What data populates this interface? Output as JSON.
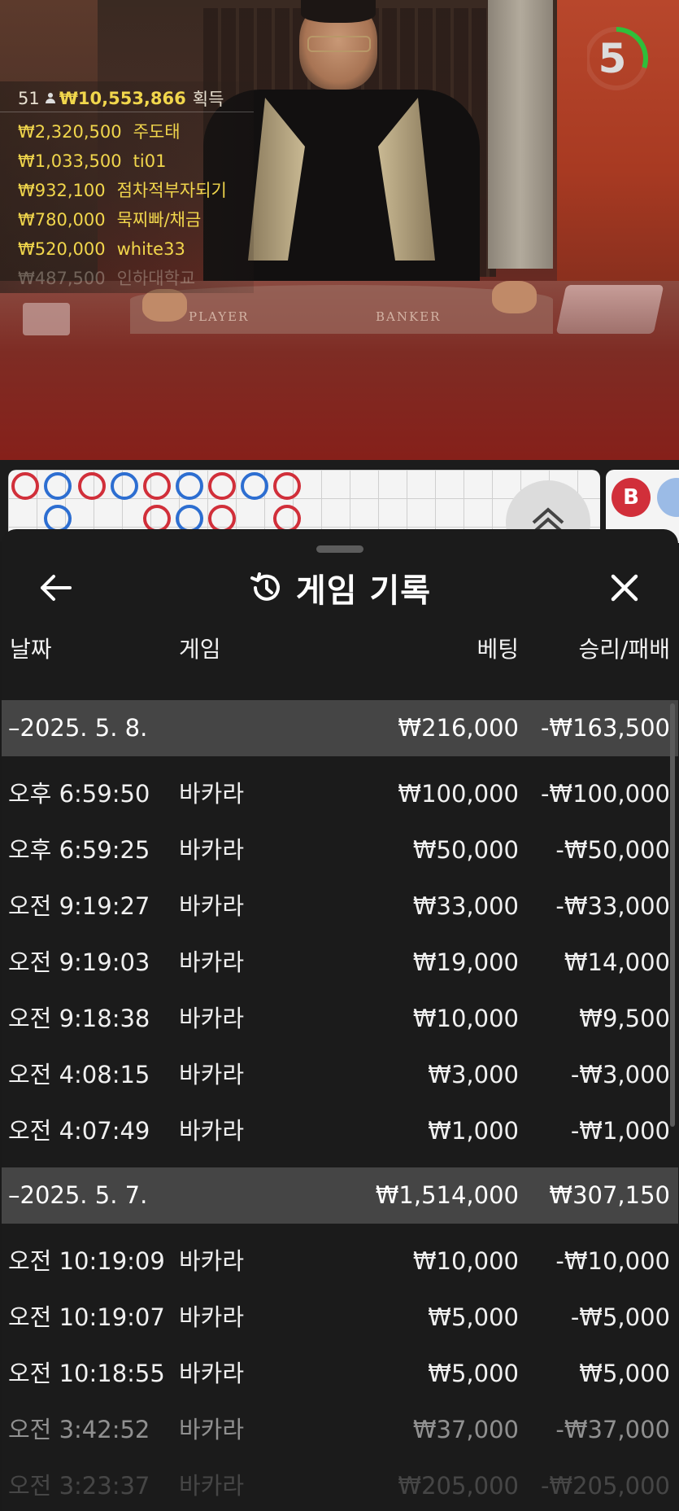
{
  "video": {
    "felt_player": "PLAYER",
    "felt_banker": "BANKER",
    "timer": {
      "value": "5",
      "progress": 0.3,
      "color": "#2fbf3a"
    }
  },
  "leaderboard": {
    "count": "51",
    "total": "₩10,553,866",
    "suffix": "획득",
    "entries": [
      {
        "amount": "₩2,320,500",
        "name": "주도태"
      },
      {
        "amount": "₩1,033,500",
        "name": "ti01"
      },
      {
        "amount": "₩932,100",
        "name": "점차적부자되기"
      },
      {
        "amount": "₩780,000",
        "name": "묵찌빠/채금"
      },
      {
        "amount": "₩520,000",
        "name": "white33"
      },
      {
        "amount": "₩487,500",
        "name": "인하대학교"
      }
    ]
  },
  "roadmap": {
    "badge": "B",
    "player_color": "#2d6ed1",
    "banker_color": "#d12f3a"
  },
  "sheet": {
    "title": "게임 기록",
    "icons": {
      "back": "arrow-left-icon",
      "history": "history-icon",
      "close": "close-icon"
    },
    "columns": {
      "date": "날짜",
      "game": "게임",
      "bet": "베팅",
      "result": "승리/패배"
    },
    "groups": [
      {
        "date": "–2025. 5. 8.",
        "bet": "₩216,000",
        "result": "-₩163,500",
        "rows": [
          {
            "time": "오후 6:59:50",
            "game": "바카라",
            "bet": "₩100,000",
            "result": "-₩100,000"
          },
          {
            "time": "오후 6:59:25",
            "game": "바카라",
            "bet": "₩50,000",
            "result": "-₩50,000"
          },
          {
            "time": "오전 9:19:27",
            "game": "바카라",
            "bet": "₩33,000",
            "result": "-₩33,000"
          },
          {
            "time": "오전 9:19:03",
            "game": "바카라",
            "bet": "₩19,000",
            "result": "₩14,000"
          },
          {
            "time": "오전 9:18:38",
            "game": "바카라",
            "bet": "₩10,000",
            "result": "₩9,500"
          },
          {
            "time": "오전 4:08:15",
            "game": "바카라",
            "bet": "₩3,000",
            "result": "-₩3,000"
          },
          {
            "time": "오전 4:07:49",
            "game": "바카라",
            "bet": "₩1,000",
            "result": "-₩1,000"
          }
        ]
      },
      {
        "date": "–2025. 5. 7.",
        "bet": "₩1,514,000",
        "result": "₩307,150",
        "rows": [
          {
            "time": "오전 10:19:09",
            "game": "바카라",
            "bet": "₩10,000",
            "result": "-₩10,000"
          },
          {
            "time": "오전 10:19:07",
            "game": "바카라",
            "bet": "₩5,000",
            "result": "-₩5,000"
          },
          {
            "time": "오전 10:18:55",
            "game": "바카라",
            "bet": "₩5,000",
            "result": "₩5,000"
          },
          {
            "time": "오전 3:42:52",
            "game": "바카라",
            "bet": "₩37,000",
            "result": "-₩37,000"
          },
          {
            "time": "오전 3:23:37",
            "game": "바카라",
            "bet": "₩205,000",
            "result": "-₩205,000"
          }
        ]
      }
    ]
  }
}
